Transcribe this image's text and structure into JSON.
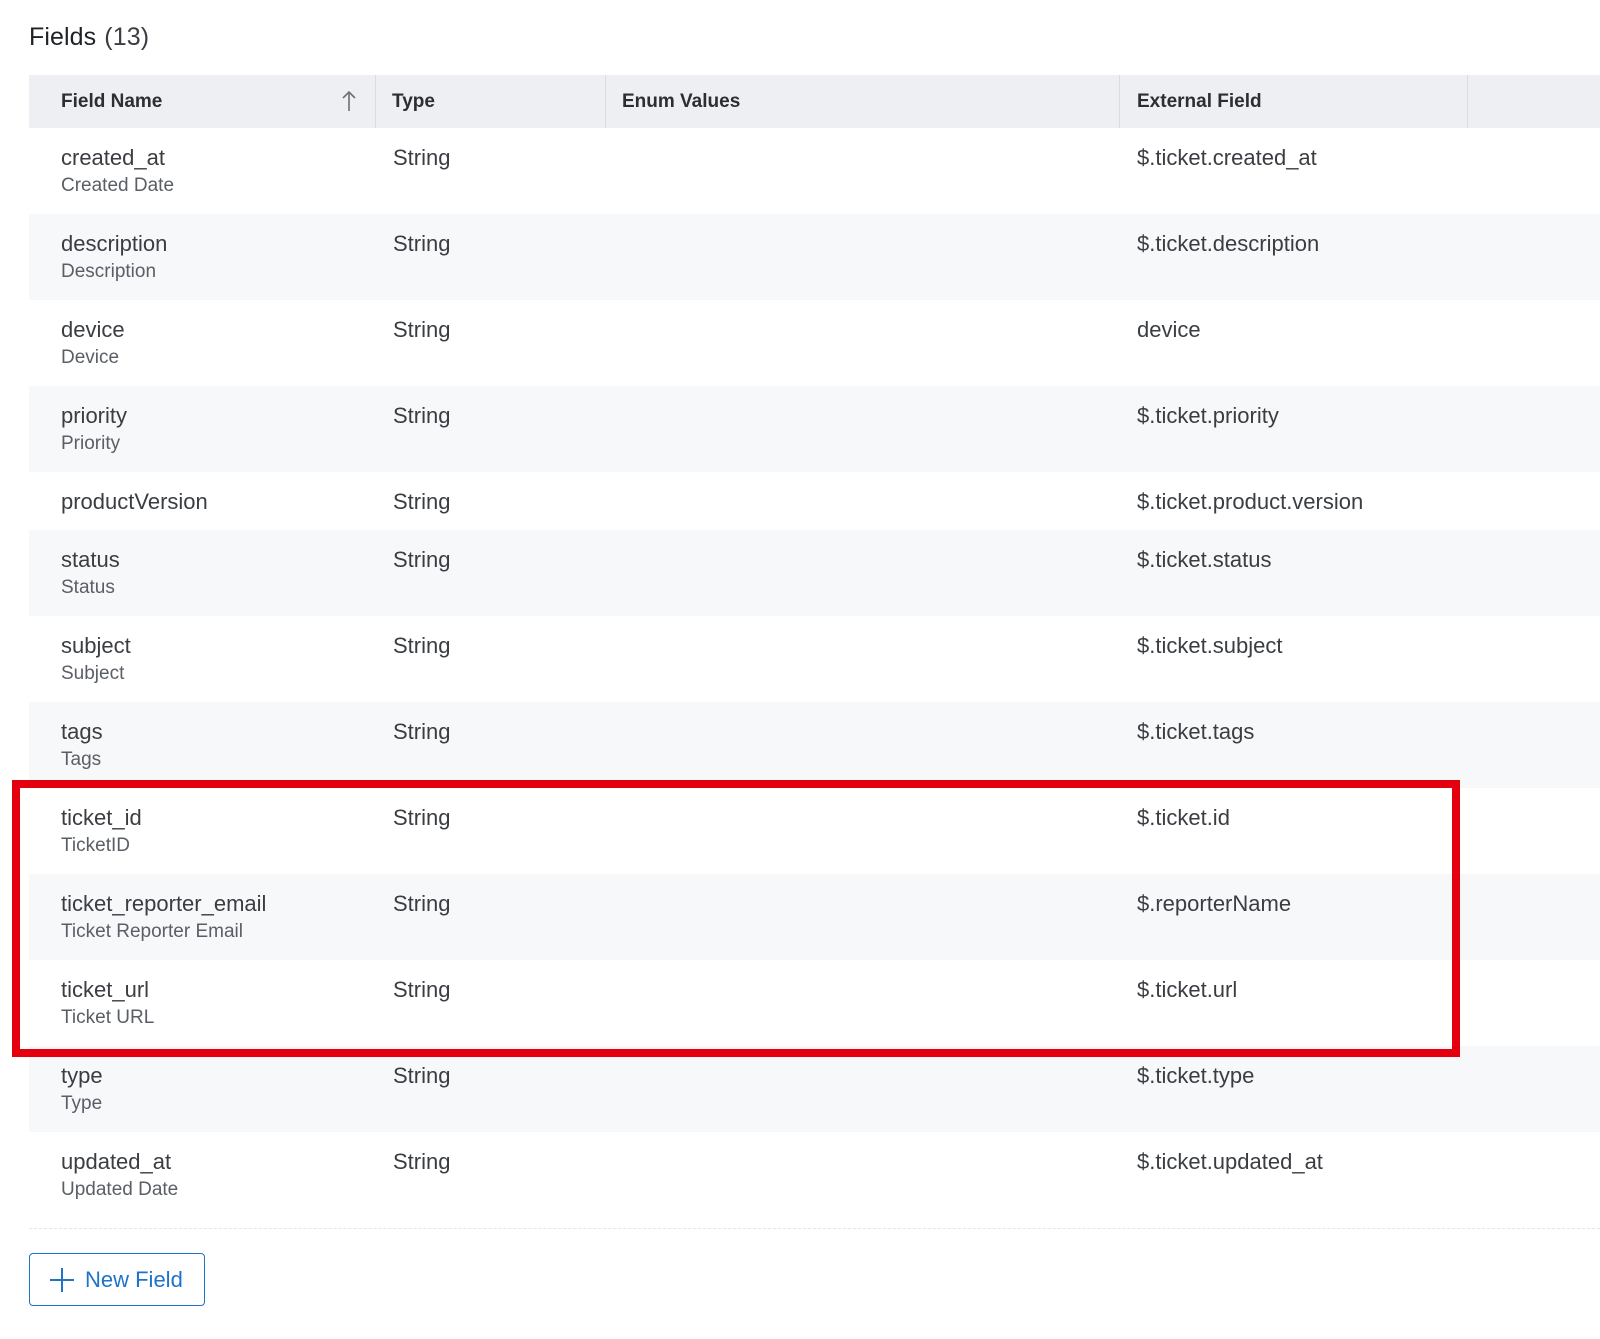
{
  "section": {
    "title": "Fields",
    "count": "(13)"
  },
  "table": {
    "headers": {
      "field_name": "Field Name",
      "type": "Type",
      "enum_values": "Enum Values",
      "external_field": "External Field"
    },
    "sort": {
      "column": "Field Name",
      "direction": "ascending",
      "icon": "arrow-up-icon"
    },
    "rows": [
      {
        "name": "created_at",
        "label": "Created Date",
        "type": "String",
        "enum_values": "",
        "external": "$.ticket.created_at"
      },
      {
        "name": "description",
        "label": "Description",
        "type": "String",
        "enum_values": "",
        "external": "$.ticket.description"
      },
      {
        "name": "device",
        "label": "Device",
        "type": "String",
        "enum_values": "",
        "external": "device"
      },
      {
        "name": "priority",
        "label": "Priority",
        "type": "String",
        "enum_values": "",
        "external": "$.ticket.priority"
      },
      {
        "name": "productVersion",
        "label": "",
        "type": "String",
        "enum_values": "",
        "external": "$.ticket.product.version"
      },
      {
        "name": "status",
        "label": "Status",
        "type": "String",
        "enum_values": "",
        "external": "$.ticket.status"
      },
      {
        "name": "subject",
        "label": "Subject",
        "type": "String",
        "enum_values": "",
        "external": "$.ticket.subject"
      },
      {
        "name": "tags",
        "label": "Tags",
        "type": "String",
        "enum_values": "",
        "external": "$.ticket.tags"
      },
      {
        "name": "ticket_id",
        "label": "TicketID",
        "type": "String",
        "enum_values": "",
        "external": "$.ticket.id"
      },
      {
        "name": "ticket_reporter_email",
        "label": "Ticket Reporter Email",
        "type": "String",
        "enum_values": "",
        "external": "$.reporterName"
      },
      {
        "name": "ticket_url",
        "label": "Ticket URL",
        "type": "String",
        "enum_values": "",
        "external": "$.ticket.url"
      },
      {
        "name": "type",
        "label": "Type",
        "type": "String",
        "enum_values": "",
        "external": "$.ticket.type"
      },
      {
        "name": "updated_at",
        "label": "Updated Date",
        "type": "String",
        "enum_values": "",
        "external": "$.ticket.updated_at"
      }
    ]
  },
  "actions": {
    "new_field_label": "New Field",
    "new_field_icon": "plus-icon"
  },
  "highlight": {
    "color": "#e3000f",
    "rows": [
      "ticket_id",
      "ticket_reporter_email",
      "ticket_url"
    ]
  },
  "colors": {
    "accent": "#1f73c9",
    "header_bg": "#eeeff3",
    "row_alt_bg": "#f7f8fa"
  }
}
